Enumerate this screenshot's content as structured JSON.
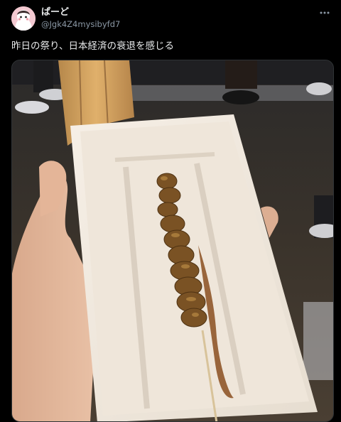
{
  "post": {
    "author": {
      "display_name": "ぱーど",
      "handle": "@Jgk4Z4mysibyfd7"
    },
    "text": "昨日の祭り、日本経済の衰退を感じる",
    "more_icon": "ellipsis-icon",
    "media_icon": "photo-yakitori-skewer-on-foam-tray"
  },
  "theme": {
    "background": "#000000",
    "text_primary": "#e7e9ea",
    "text_secondary": "#8b98a5",
    "border": "#2f3336"
  }
}
